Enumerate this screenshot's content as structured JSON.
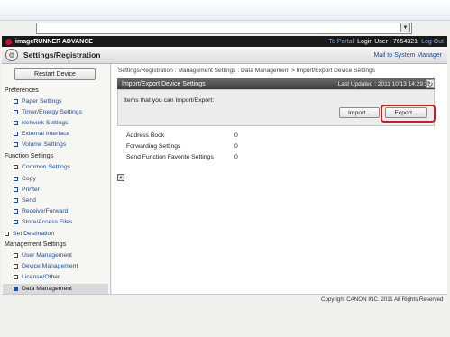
{
  "browser": {
    "dropdown_arrow": "▼"
  },
  "header": {
    "brand": "imageRUNNER ADVANCE",
    "to_portal": "To Portal",
    "login_user": "Login User : 7654321",
    "log_out": "Log Out"
  },
  "titlebar": {
    "title": "Settings/Registration",
    "mail": "Mail to System Manager"
  },
  "sidebar": {
    "restart": "Restart Device",
    "groups": [
      {
        "heading": "Preferences",
        "items": [
          "Paper Settings",
          "Timer/Energy Settings",
          "Network Settings",
          "External Interface",
          "Volume Settings"
        ]
      },
      {
        "heading": "Function Settings",
        "items": [
          "Common Settings",
          "Copy",
          "Printer",
          "Send",
          "Receive/Forward",
          "Store/Access Files"
        ]
      },
      {
        "heading": "Set Destination",
        "items": []
      },
      {
        "heading": "Management Settings",
        "items": [
          "User Management",
          "Device Management",
          "License/Other",
          "Data Management"
        ]
      }
    ]
  },
  "breadcrumb": "Settings/Registration : Management Settings : Data Management > Import/Export Device Settings",
  "panel": {
    "title": "Import/Export Device Settings",
    "last_updated": "Last Updated : 2011 10/13 14:29:32",
    "description": "Items that you can Import/Export:",
    "import_label": "Import...",
    "export_label": "Export..."
  },
  "items": [
    {
      "label": "Address Book",
      "value": "0"
    },
    {
      "label": "Forwarding Settings",
      "value": "0"
    },
    {
      "label": "Send Function Favorite Settings",
      "value": "0"
    }
  ],
  "footer": {
    "copyright": "Copyright CANON INC. 2011 All Rights Reserved"
  },
  "colors": {
    "highlight_ring": "#d61a1a",
    "link": "#1a4fa0",
    "header_bg": "#1a1a1a"
  }
}
